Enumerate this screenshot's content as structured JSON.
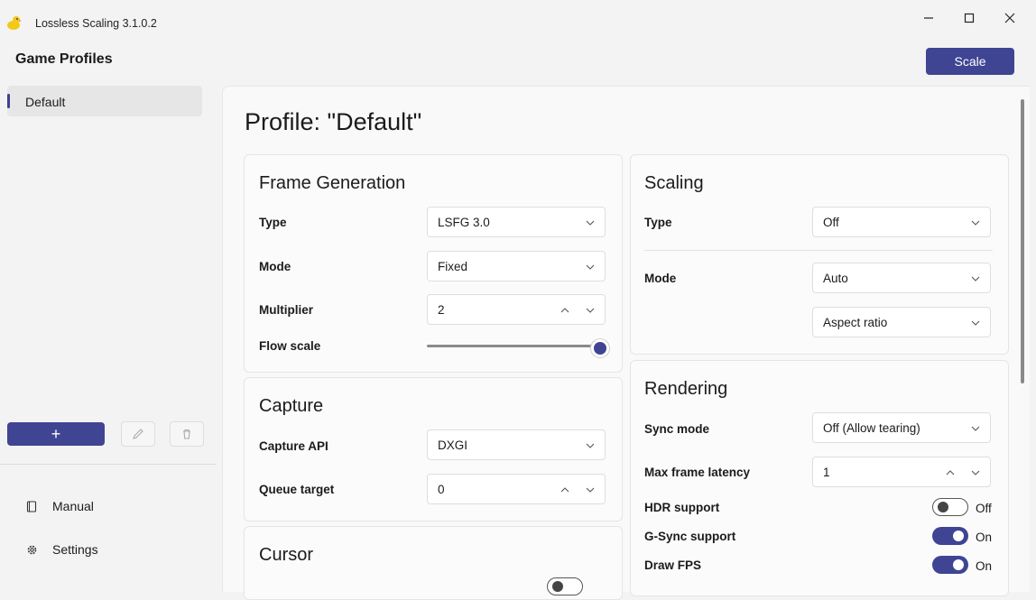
{
  "app": {
    "title": "Lossless Scaling 3.1.0.2",
    "icon": "duck-icon",
    "accent": "#3f4593"
  },
  "sidebar": {
    "title": "Game Profiles",
    "profiles": [
      {
        "label": "Default"
      }
    ],
    "add_label": "+",
    "nav": [
      {
        "label": "Manual",
        "icon": "book-icon"
      },
      {
        "label": "Settings",
        "icon": "gear-icon"
      }
    ]
  },
  "header": {
    "scale_label": "Scale"
  },
  "main": {
    "title": "Profile: \"Default\"",
    "frame_generation": {
      "title": "Frame Generation",
      "type_label": "Type",
      "type_value": "LSFG 3.0",
      "mode_label": "Mode",
      "mode_value": "Fixed",
      "multiplier_label": "Multiplier",
      "multiplier_value": "2",
      "flow_label": "Flow scale",
      "flow_value": 1.0
    },
    "capture": {
      "title": "Capture",
      "api_label": "Capture API",
      "api_value": "DXGI",
      "queue_label": "Queue target",
      "queue_value": "0"
    },
    "cursor": {
      "title": "Cursor"
    },
    "scaling": {
      "title": "Scaling",
      "type_label": "Type",
      "type_value": "Off",
      "mode_label": "Mode",
      "mode_value": "Auto",
      "aspect_value": "Aspect ratio"
    },
    "rendering": {
      "title": "Rendering",
      "sync_label": "Sync mode",
      "sync_value": "Off (Allow tearing)",
      "latency_label": "Max frame latency",
      "latency_value": "1",
      "hdr_label": "HDR support",
      "hdr_state": "Off",
      "gsync_label": "G-Sync support",
      "gsync_state": "On",
      "fps_label": "Draw FPS",
      "fps_state": "On"
    }
  }
}
